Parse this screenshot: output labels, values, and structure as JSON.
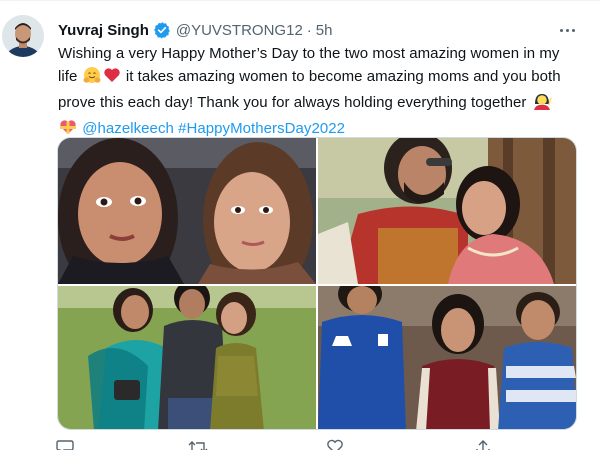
{
  "tweet": {
    "author": {
      "name": "Yuvraj Singh",
      "handle": "@YUVSTRONG12",
      "separator": "·",
      "time": "5h",
      "verified": true,
      "avatar_icon": "profile-photo"
    },
    "text": {
      "line1": "Wishing a very Happy Mother’s Day to the two most amazing women in my",
      "line2_a": "life",
      "line2_b": "it takes amazing women to become amazing moms and you both",
      "line3": "prove this each day! Thank you for always holding everything together",
      "mention": "@hazelkeech",
      "hashtag": "#HappyMothersDay2022"
    },
    "emojis": [
      "hugging-face",
      "red-heart",
      "woman-raising-hand",
      "heart-with-ribbon"
    ],
    "photos": [
      {
        "name": "selfie-two-women"
      },
      {
        "name": "couple-wedding-outfit"
      },
      {
        "name": "trio-on-lawn"
      },
      {
        "name": "group-blue-jerseys"
      }
    ],
    "actions": [
      "reply-icon",
      "retweet-icon",
      "like-icon",
      "share-icon"
    ],
    "colors": {
      "link": "#1d9bf0",
      "verified": "#1d9bf0",
      "secondary_text": "#536471",
      "border": "#cfd9de"
    }
  }
}
